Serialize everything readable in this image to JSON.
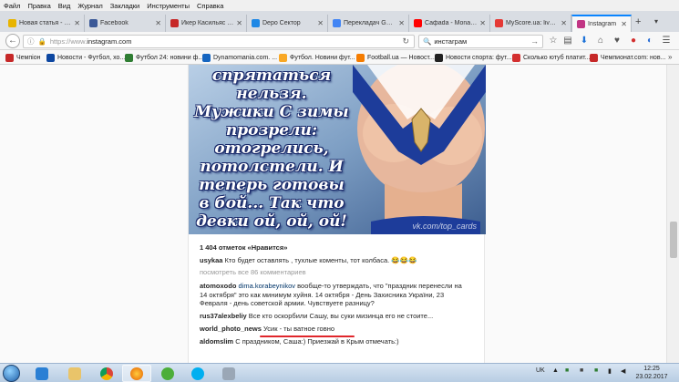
{
  "menu": [
    "Файл",
    "Правка",
    "Вид",
    "Журнал",
    "Закладки",
    "Инструменты",
    "Справка"
  ],
  "tabs": [
    {
      "label": "Новая статья - СPan...",
      "color": "#e8b400"
    },
    {
      "label": "Facebook",
      "color": "#3b5998"
    },
    {
      "label": "Икер Касильяс у...",
      "color": "#c62828"
    },
    {
      "label": "Depo Сектор",
      "color": "#1e88e5"
    },
    {
      "label": "Перекладач Goo...",
      "color": "#4285f4"
    },
    {
      "label": "Сафаda - Monac...",
      "color": "#ff0000"
    },
    {
      "label": "MyScore.ua: live ...",
      "color": "#e53935"
    },
    {
      "label": "Instagram",
      "color": "#c13584"
    }
  ],
  "nav": {
    "url_prefix": "https://www.",
    "url_domain": "instagram.com",
    "search_value": "инстаграм"
  },
  "bookmarks": [
    {
      "label": "Чемпіон",
      "color": "#c62828"
    },
    {
      "label": "Новости - Футбол, хо...",
      "color": "#0d47a1"
    },
    {
      "label": "Футбол 24: новини ф...",
      "color": "#2e7d32"
    },
    {
      "label": "Dynamomania.com. ...",
      "color": "#1565c0"
    },
    {
      "label": "Футбол. Новини фут...",
      "color": "#f9a825"
    },
    {
      "label": "Football.ua — Новост...",
      "color": "#f57c00"
    },
    {
      "label": "Новости спорта: фут...",
      "color": "#212121"
    },
    {
      "label": "Сколько ютуб платит...",
      "color": "#d32f2f"
    },
    {
      "label": "Чемпионат.com: нов...",
      "color": "#c62828"
    }
  ],
  "post": {
    "caption": "спрятаться нельзя. Мужики С зимы прозрели: отогрелись, потолстели. И теперь готовы в бой... Так что девки ой, ой, ой!",
    "watermark": "vk.com/top_cards",
    "likes_count": "1 404 отметок «Нравится»",
    "comments": [
      {
        "user": "usykaa",
        "text": "Кто будет оставлять , тухлые коменты, тот колбаса. 😂😂😂"
      },
      {
        "view_all": "посмотреть все 86 комментариев"
      },
      {
        "user": "atomoxodo",
        "mention": "dima.korabeynikov",
        "text": "вообще-то утверждать, что \"праздник перенесли на 14 октября\" это как минимум хуйня. 14 октября - День Захисника України, 23 Февраля - день советской армии. Чувствуете разницу?"
      },
      {
        "user": "rus37alexbeliy",
        "text": "Все кто оскорбили Сашу, вы суки мизинца его не стоите..."
      },
      {
        "user": "world_photo_news",
        "text": "Усик - ты ватное говно"
      },
      {
        "user": "aldomslim",
        "text": "С праздником, Саша:) Приезжай в Крым отмечать:)"
      }
    ]
  },
  "taskbar": {
    "lang": "UK",
    "time": "12:25",
    "date": "23.02.2017"
  }
}
